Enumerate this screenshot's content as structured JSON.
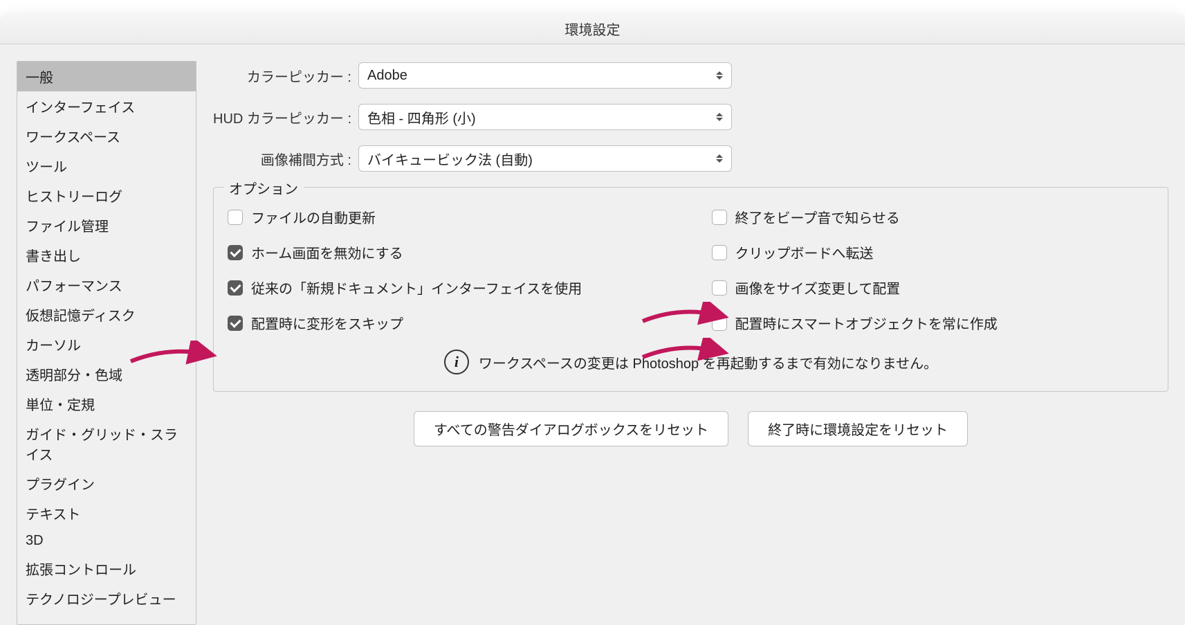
{
  "window": {
    "title": "環境設定"
  },
  "sidebar": {
    "items": [
      "一般",
      "インターフェイス",
      "ワークスペース",
      "ツール",
      "ヒストリーログ",
      "ファイル管理",
      "書き出し",
      "パフォーマンス",
      "仮想記憶ディスク",
      "カーソル",
      "透明部分・色域",
      "単位・定規",
      "ガイド・グリッド・スライス",
      "プラグイン",
      "テキスト",
      "3D",
      "拡張コントロール",
      "テクノロジープレビュー"
    ],
    "selected_index": 0
  },
  "form": {
    "color_picker_label": "カラーピッカー :",
    "color_picker_value": "Adobe",
    "hud_picker_label": "HUD カラーピッカー :",
    "hud_picker_value": "色相 - 四角形 (小)",
    "interpolation_label": "画像補間方式 :",
    "interpolation_value": "バイキュービック法 (自動)"
  },
  "options": {
    "legend": "オプション",
    "left": [
      {
        "label": "ファイルの自動更新",
        "checked": false
      },
      {
        "label": "ホーム画面を無効にする",
        "checked": true
      },
      {
        "label": "従来の「新規ドキュメント」インターフェイスを使用",
        "checked": true
      },
      {
        "label": "配置時に変形をスキップ",
        "checked": true
      }
    ],
    "right": [
      {
        "label": "終了をビープ音で知らせる",
        "checked": false
      },
      {
        "label": "クリップボードへ転送",
        "checked": false
      },
      {
        "label": "画像をサイズ変更して配置",
        "checked": false
      },
      {
        "label": "配置時にスマートオブジェクトを常に作成",
        "checked": false
      }
    ],
    "info_text": "ワークスペースの変更は Photoshop を再起動するまで有効になりません。"
  },
  "buttons": {
    "reset_warnings": "すべての警告ダイアログボックスをリセット",
    "reset_on_quit": "終了時に環境設定をリセット"
  },
  "annotation": {
    "arrow_color": "#c2185b"
  }
}
